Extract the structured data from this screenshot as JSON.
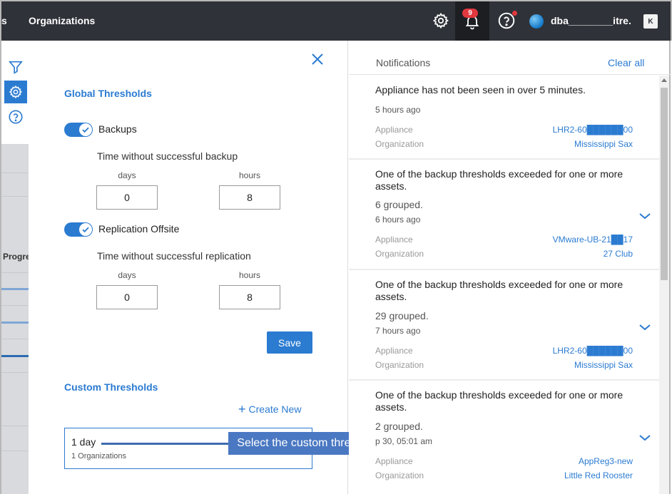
{
  "topbar": {
    "crumb_fragment": "s",
    "title": "Organizations",
    "notification_count": "9",
    "user": "dba________itre...",
    "logo": "K"
  },
  "leftrail": {
    "column_fragment": "Progre"
  },
  "panel": {
    "global_title": "Global Thresholds",
    "backups": {
      "label": "Backups",
      "enabled": true,
      "subheading": "Time without successful backup",
      "days_label": "days",
      "hours_label": "hours",
      "days_value": "0",
      "hours_value": "8"
    },
    "replication": {
      "label": "Replication Offsite",
      "enabled": true,
      "subheading": "Time without successful replication",
      "days_label": "days",
      "hours_label": "hours",
      "days_value": "0",
      "hours_value": "8"
    },
    "save_label": "Save",
    "custom_title": "Custom Thresholds",
    "create_new_label": "Create New",
    "custom_item": {
      "name": "1 day",
      "sub": "1 Organizations"
    },
    "tooltip": "Select the custom threshold"
  },
  "notifications": {
    "title": "Notifications",
    "clear_all": "Clear all",
    "items": [
      {
        "title": "Appliance has not been seen in over 5 minutes.",
        "grouped": "",
        "time": "5 hours ago",
        "k1": "Appliance",
        "v1": "LHR2-60██████00",
        "k2": "Organization",
        "v2": "Mississippi Sax"
      },
      {
        "title": "One of the backup thresholds exceeded for one or more assets.",
        "grouped": "6 grouped.",
        "time": "6 hours ago",
        "k1": "Appliance",
        "v1": "VMware-UB-21██17",
        "k2": "Organization",
        "v2": "27 Club"
      },
      {
        "title": "One of the backup thresholds exceeded for one or more assets.",
        "grouped": "29 grouped.",
        "time": "7 hours ago",
        "k1": "Appliance",
        "v1": "LHR2-60██████00",
        "k2": "Organization",
        "v2": "Mississippi Sax"
      },
      {
        "title": "One of the backup thresholds exceeded for one or more assets.",
        "grouped": "2 grouped.",
        "time": "p 30, 05:01 am",
        "k1": "Appliance",
        "v1": "AppReg3-new",
        "k2": "Organization",
        "v2": "Little Red Rooster"
      }
    ]
  },
  "colors": {
    "accent": "#2b7bd1",
    "topbar": "#2f3238",
    "badge": "#e0383e",
    "tooltip": "#4a78c2"
  }
}
